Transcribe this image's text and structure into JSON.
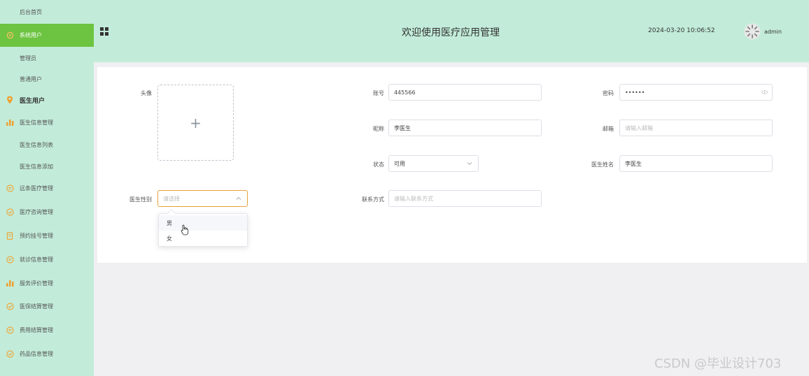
{
  "sidebar": {
    "items": [
      {
        "label": "后台首页",
        "icon": ""
      },
      {
        "label": "系统用户",
        "icon": "gear-icon"
      },
      {
        "label": "管理员",
        "icon": ""
      },
      {
        "label": "普通用户",
        "icon": ""
      },
      {
        "label": "医生用户",
        "icon": "location-pin-icon"
      },
      {
        "label": "医生信息管理",
        "icon": "bar-chart-icon"
      },
      {
        "label": "医生信息列表",
        "icon": ""
      },
      {
        "label": "医生信息添加",
        "icon": ""
      },
      {
        "label": "远条医疗管理",
        "icon": "chat-icon"
      },
      {
        "label": "医疗咨询管理",
        "icon": "check-circle-icon"
      },
      {
        "label": "预约挂号管理",
        "icon": "document-icon"
      },
      {
        "label": "就诊信息管理",
        "icon": "chat-icon"
      },
      {
        "label": "服务评价管理",
        "icon": "bar-chart-icon"
      },
      {
        "label": "医保结算管理",
        "icon": "check-circle-icon"
      },
      {
        "label": "费用结算管理",
        "icon": "chat-icon"
      },
      {
        "label": "药品信息管理",
        "icon": "check-circle-icon"
      }
    ]
  },
  "header": {
    "title": "欢迎使用医疗应用管理",
    "datetime": "2024-03-20 10:06:52",
    "user": "admin"
  },
  "form": {
    "avatar_label": "头像",
    "upload_plus": "+",
    "account_label": "账号",
    "account_value": "445566",
    "password_label": "密码",
    "password_value": "••••••",
    "nickname_label": "昵称",
    "nickname_value": "李医生",
    "email_label": "邮箱",
    "email_placeholder": "请输入邮箱",
    "status_label": "状态",
    "status_value": "可用",
    "doctor_name_label": "医生姓名",
    "doctor_name_value": "李医生",
    "gender_label": "医生性别",
    "gender_placeholder": "请选择",
    "contact_label": "联系方式",
    "contact_placeholder": "请输入联系方式"
  },
  "dropdown": {
    "options": [
      "男",
      "女"
    ]
  },
  "watermark": "CSDN @毕业设计703",
  "colors": {
    "sidebar_bg": "#c2ecd9",
    "active_bg": "#6dc441",
    "icon_orange": "#f0a030"
  }
}
